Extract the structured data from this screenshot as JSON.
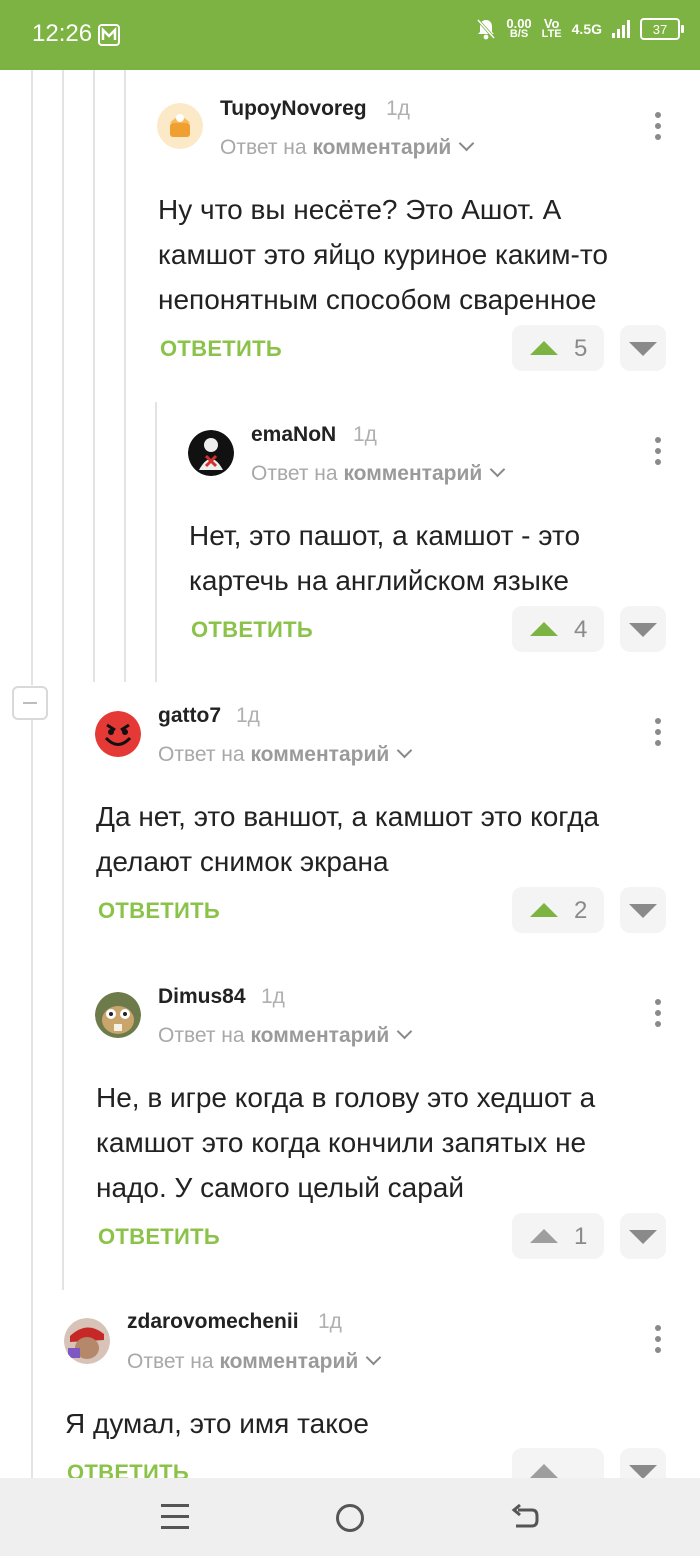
{
  "status_bar": {
    "time": "12:26",
    "net_speed_value": "0.00",
    "net_speed_unit": "B/S",
    "volte_top": "Vo",
    "volte_bottom": "LTE",
    "network": "4.5G",
    "battery": "37"
  },
  "comments": [
    {
      "author": "TupoyNovoreg",
      "age": "1д",
      "reply_prefix": "Ответ на",
      "reply_target": "комментарий",
      "lines": [
        "Ну что вы несёте? Это Ашот. А",
        "камшот это яйцо куриное каким-то",
        "непонятным способом сваренное"
      ],
      "reply_label": "ОТВЕТИТЬ",
      "votes": "5"
    },
    {
      "author": "emaNoN",
      "age": "1д",
      "reply_prefix": "Ответ на",
      "reply_target": "комментарий",
      "lines": [
        "Нет, это пашот, а камшот - это",
        "картечь на английском языке"
      ],
      "reply_label": "ОТВЕТИТЬ",
      "votes": "4"
    },
    {
      "author": "gatto7",
      "age": "1д",
      "reply_prefix": "Ответ на",
      "reply_target": "комментарий",
      "lines": [
        "Да нет, это ваншот, а камшот это когда",
        "делают снимок экрана"
      ],
      "reply_label": "ОТВЕТИТЬ",
      "votes": "2"
    },
    {
      "author": "Dimus84",
      "age": "1д",
      "reply_prefix": "Ответ на",
      "reply_target": "комментарий",
      "lines": [
        "Не, в игре когда в голову это хедшот а",
        "камшот это когда кончили запятых не",
        "надо. У самого целый сарай"
      ],
      "reply_label": "ОТВЕТИТЬ",
      "votes": "1"
    },
    {
      "author": "zdarovomechenii",
      "age": "1д",
      "reply_prefix": "Ответ на",
      "reply_target": "комментарий",
      "lines": [
        "Я думал, это имя такое"
      ],
      "reply_label": "ОТВЕТИТЬ"
    }
  ],
  "icons": {
    "menu": "menu-icon",
    "more": "more-vertical-icon",
    "upvote": "arrow-up-icon",
    "downvote": "arrow-down-icon",
    "collapse": "minus-icon"
  },
  "colors": {
    "brand": "#7cb342",
    "reply": "#8bc34a"
  }
}
